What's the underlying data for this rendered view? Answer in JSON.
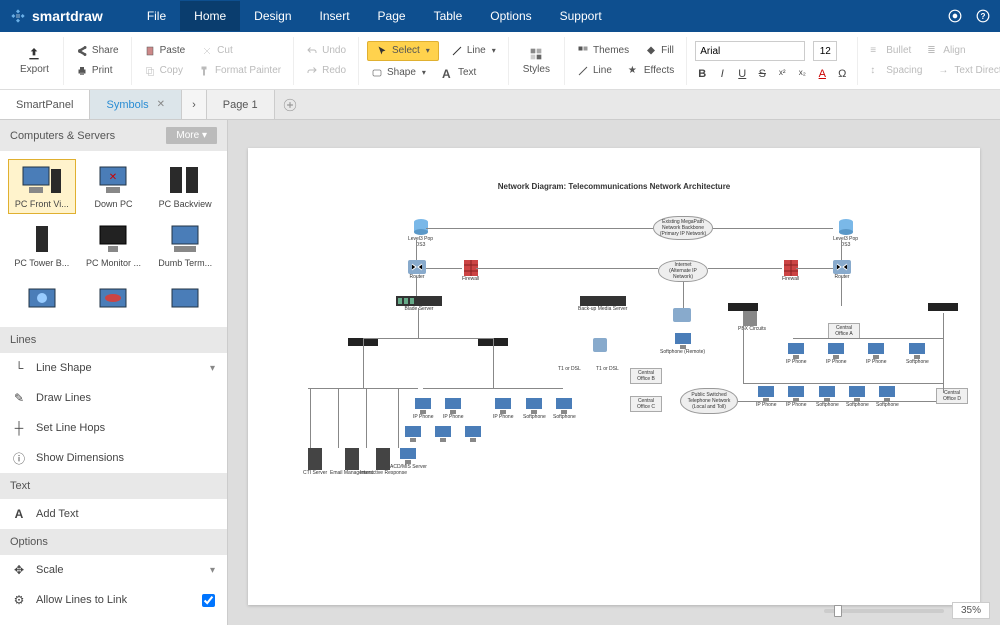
{
  "app": {
    "name": "smartdraw"
  },
  "menu": {
    "items": [
      "File",
      "Home",
      "Design",
      "Insert",
      "Page",
      "Table",
      "Options",
      "Support"
    ],
    "active": "Home"
  },
  "ribbon": {
    "export": "Export",
    "share": "Share",
    "print": "Print",
    "paste": "Paste",
    "cut": "Cut",
    "copy": "Copy",
    "format_painter": "Format Painter",
    "undo": "Undo",
    "redo": "Redo",
    "select": "Select",
    "shape": "Shape",
    "line": "Line",
    "text": "Text",
    "styles": "Styles",
    "themes": "Themes",
    "fill": "Fill",
    "line2": "Line",
    "effects": "Effects",
    "bullet": "Bullet",
    "align": "Align",
    "spacing": "Spacing",
    "text_direction": "Text Direction",
    "font_name": "Arial",
    "font_size": "12"
  },
  "tabs": {
    "smartpanel": "SmartPanel",
    "symbols": "Symbols",
    "page1": "Page 1"
  },
  "sidebar": {
    "symbols_header": "Computers & Servers",
    "more": "More",
    "symbols": [
      {
        "label": "PC Front Vi...",
        "selected": true
      },
      {
        "label": "Down PC"
      },
      {
        "label": "PC Backview"
      },
      {
        "label": "PC Tower B..."
      },
      {
        "label": "PC Monitor ..."
      },
      {
        "label": "Dumb Term..."
      },
      {
        "label": ""
      },
      {
        "label": ""
      },
      {
        "label": ""
      }
    ],
    "lines_header": "Lines",
    "lines": {
      "line_shape": "Line Shape",
      "draw_lines": "Draw Lines",
      "set_line_hops": "Set Line Hops",
      "show_dimensions": "Show Dimensions"
    },
    "text_header": "Text",
    "text": {
      "add_text": "Add Text"
    },
    "options_header": "Options",
    "options": {
      "scale": "Scale",
      "allow_lines": "Allow Lines to Link",
      "allow_lines_checked": true
    }
  },
  "diagram": {
    "title": "Network Diagram: Telecommunications Network Architecture",
    "clouds": {
      "backbone": "Existing MegaPath Network Backbone (Primary IP Network)",
      "internet": "Internet (Alternate IP Network)",
      "pstn": "Public Switched Telephone Network (Local and Toll)"
    },
    "labels": {
      "level3_pop_l": "Level3 Pop",
      "level3_pop_r": "Level3 Pop",
      "ds3_l": "DS3",
      "ds3_r": "DS3",
      "router_l": "Router",
      "router_r": "Router",
      "firewall_l": "Firewall",
      "firewall_r": "Firewall",
      "blade_server": "Blade Server",
      "backup_media": "Back-up Media Server",
      "softphone_remote": "Softphone (Remote)",
      "pbx": "PBX Circuits",
      "co_a": "Central Office A",
      "co_b": "Central Office B",
      "co_c": "Central Office C",
      "co_d": "Central Office D",
      "t1": "T1 or DSL",
      "ip_phone": "IP Phone",
      "softphone": "Softphone",
      "cti": "CTI Server",
      "email": "Email Management",
      "ivr": "Interactive Response",
      "acd": "ACD/MIS Server"
    }
  },
  "zoom": {
    "value": "35%"
  }
}
